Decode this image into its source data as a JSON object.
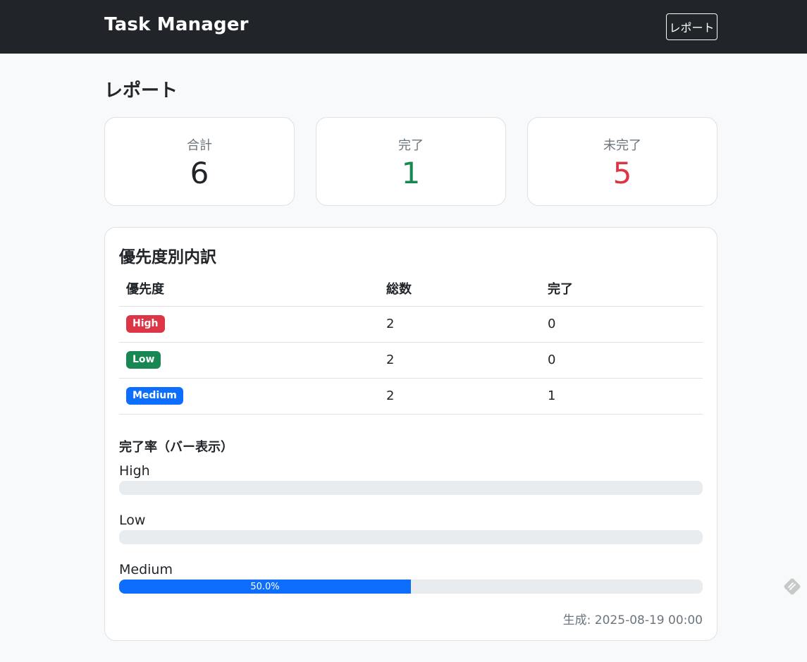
{
  "navbar": {
    "brand": "Task Manager",
    "report_button": "レポート"
  },
  "page": {
    "title": "レポート"
  },
  "stats": [
    {
      "label": "合計",
      "value": "6",
      "color": "#212529"
    },
    {
      "label": "完了",
      "value": "1",
      "color": "#198754"
    },
    {
      "label": "未完了",
      "value": "5",
      "color": "#dc3545"
    }
  ],
  "breakdown": {
    "title": "優先度別内訳",
    "columns": [
      "優先度",
      "総数",
      "完了"
    ],
    "rows": [
      {
        "priority": "High",
        "total": "2",
        "done": "0",
        "color": "#dc3545"
      },
      {
        "priority": "Low",
        "total": "2",
        "done": "0",
        "color": "#198754"
      },
      {
        "priority": "Medium",
        "total": "2",
        "done": "1",
        "color": "#0d6efd"
      }
    ]
  },
  "completion": {
    "title": "完了率（バー表示）",
    "bars": [
      {
        "label": "High",
        "percent": 0,
        "text": ""
      },
      {
        "label": "Low",
        "percent": 0,
        "text": ""
      },
      {
        "label": "Medium",
        "percent": 50,
        "text": "50.0%"
      }
    ],
    "bar_color": "#0d6efd"
  },
  "footer": {
    "generated": "生成: 2025-08-19 00:00"
  },
  "icons": {
    "corner": "pencil-icon"
  }
}
